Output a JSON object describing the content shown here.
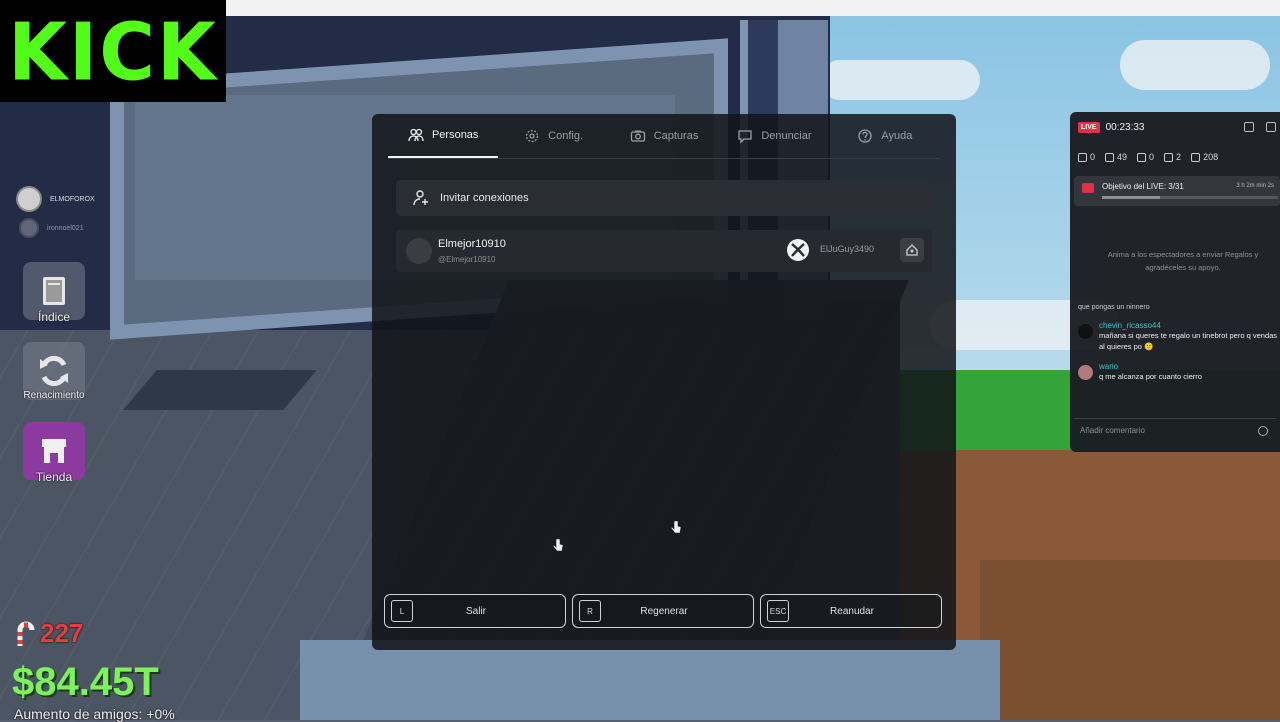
{
  "brand": {
    "logo_text": "KICK",
    "color": "#53fc18"
  },
  "players": [
    "ELMOFOROX",
    "ironnoel021"
  ],
  "side_buttons": [
    {
      "label": "Índice",
      "icon": "book-icon"
    },
    {
      "label": "Renacimiento",
      "icon": "refresh-icon"
    },
    {
      "label": "Tienda",
      "icon": "shop-icon"
    }
  ],
  "hud": {
    "candy": "227",
    "money": "$84.45T",
    "friends_boost": "Aumento de amigos: +0%"
  },
  "menu": {
    "tabs": [
      {
        "label": "Personas",
        "icon": "people-icon",
        "active": true
      },
      {
        "label": "Config.",
        "icon": "gear-icon",
        "active": false
      },
      {
        "label": "Capturas",
        "icon": "camera-icon",
        "active": false
      },
      {
        "label": "Denunciar",
        "icon": "report-icon",
        "active": false
      },
      {
        "label": "Ayuda",
        "icon": "help-icon",
        "active": false
      }
    ],
    "invite_label": "Invitar conexiones",
    "friend": {
      "display_name": "Elmejor10910",
      "username": "@Elmejor10910",
      "gamertag": "ElJuGuy3490"
    },
    "footer": [
      {
        "key": "L",
        "label": "Salir"
      },
      {
        "key": "R",
        "label": "Regenerar"
      },
      {
        "key": "ESC",
        "label": "Reanudar"
      }
    ]
  },
  "stream": {
    "live_badge": "LIVE",
    "uptime": "00:23:33",
    "stats": [
      "0",
      "49",
      "0",
      "2",
      "208"
    ],
    "goal_title": "Objetivo del LIVE: 3/31",
    "goal_right": "3 h 2m min 2s",
    "goal_progress": 0.33,
    "promo_text": "Anima a los espectadores a enviar Regalos y agradéceles su apoyo.",
    "chat_cut": "que pongas un ninnero",
    "messages": [
      {
        "name": "chevin_ricasso44",
        "text": "mañana si queres te regalo un tinebrot pero q vendas al quieres po 🙂",
        "avatar": "#111111"
      },
      {
        "name": "wario",
        "text": "q me alcanza por cuanto cierro",
        "avatar": "#b07a7a"
      }
    ],
    "input_placeholder": "Añadir comentario"
  }
}
